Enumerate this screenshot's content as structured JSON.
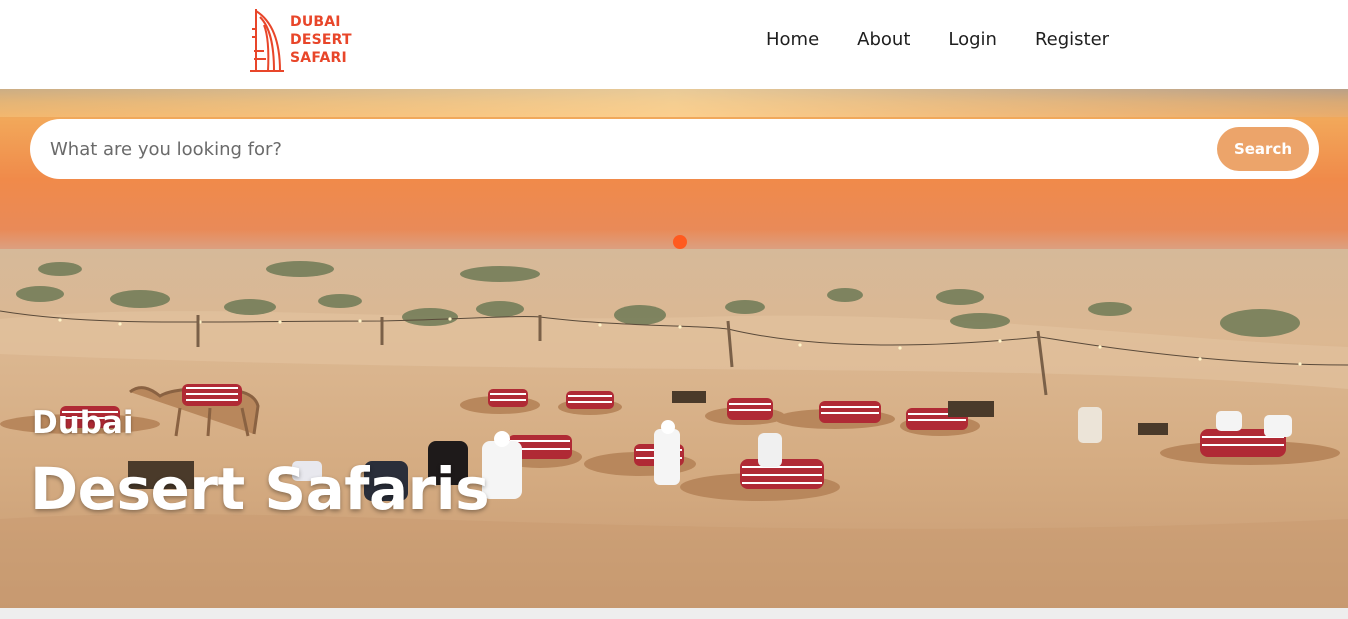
{
  "header": {
    "logo": {
      "icon": "burj-al-arab-icon",
      "line1": "DUBAI",
      "line2": "DESERT",
      "line3": "SAFARI",
      "color": "#e8462a"
    },
    "nav": [
      {
        "label": "Home"
      },
      {
        "label": "About"
      },
      {
        "label": "Login"
      },
      {
        "label": "Register"
      }
    ]
  },
  "search": {
    "placeholder": "What are you looking for?",
    "button_label": "Search",
    "button_color": "#eca46a"
  },
  "hero": {
    "subtitle": "Dubai",
    "title": "Desert Safaris",
    "image": "desert-sunset-camels-photo"
  }
}
